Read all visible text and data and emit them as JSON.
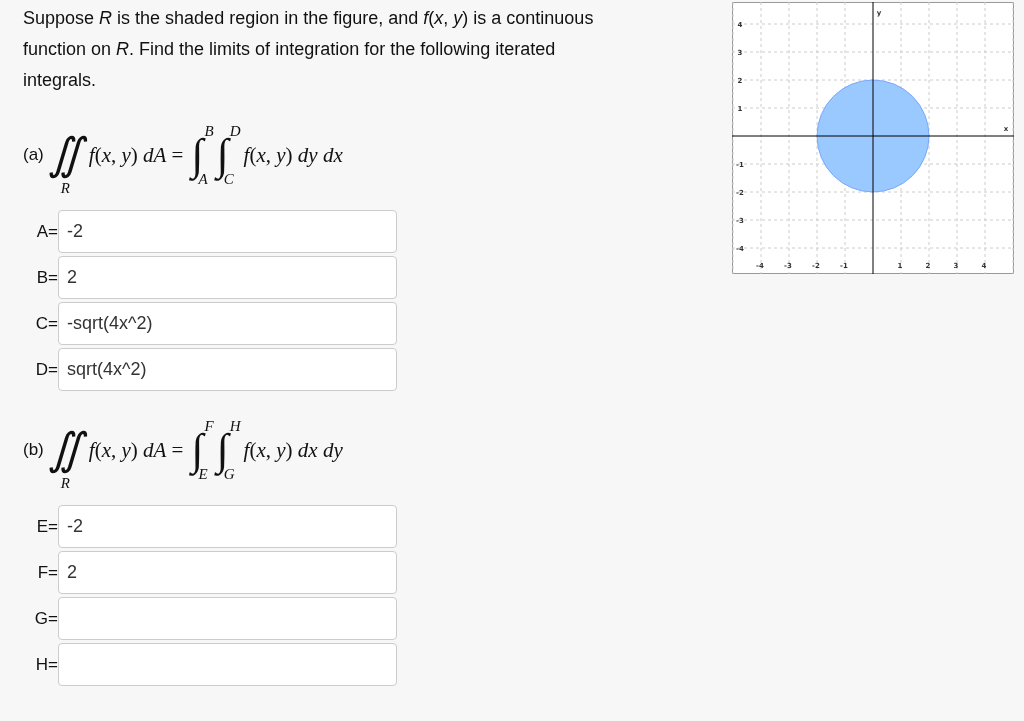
{
  "problem": {
    "text": "Suppose *R* is the shaded region in the figure, and *f*(*x*, *y*) is a continuous function on *R*. Find the limits of integration for the following iterated integrals."
  },
  "parts": [
    {
      "label": "(a)",
      "double_symbol": "∬",
      "region": "R",
      "left": "*f*(*x*, *y*) *dA* =",
      "outer": {
        "symbol": "∫",
        "lower": "A",
        "upper": "B"
      },
      "inner": {
        "symbol": "∫",
        "lower": "C",
        "upper": "D"
      },
      "right": "*f*(*x*, *y*) *dy dx*",
      "fields": [
        {
          "label": "A=",
          "value": "-2"
        },
        {
          "label": "B=",
          "value": "2"
        },
        {
          "label": "C=",
          "value": "-sqrt(4x^2)"
        },
        {
          "label": "D=",
          "value": "sqrt(4x^2)"
        }
      ]
    },
    {
      "label": "(b)",
      "double_symbol": "∬",
      "region": "R",
      "left": "*f*(*x*, *y*) *dA* =",
      "outer": {
        "symbol": "∫",
        "lower": "E",
        "upper": "F"
      },
      "inner": {
        "symbol": "∫",
        "lower": "G",
        "upper": "H"
      },
      "right": "*f*(*x*, *y*) *dx dy*",
      "fields": [
        {
          "label": "E=",
          "value": "-2"
        },
        {
          "label": "F=",
          "value": "2"
        },
        {
          "label": "G="
        },
        {
          "label": "H="
        }
      ]
    }
  ],
  "graph": {
    "x_label": "x",
    "y_label": "y",
    "x_ticks": [
      "-4",
      "-3",
      "-2",
      "-1",
      "1",
      "2",
      "3",
      "4"
    ],
    "y_ticks": [
      "4",
      "3",
      "2",
      "1",
      "-1",
      "-2",
      "-3",
      "-4"
    ]
  }
}
